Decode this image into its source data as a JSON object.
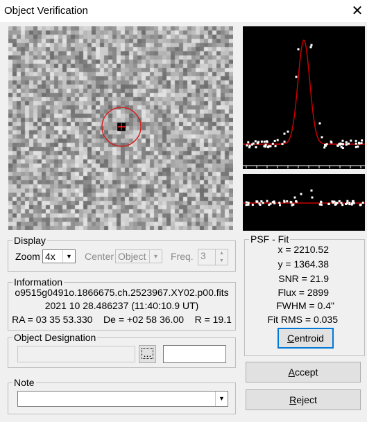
{
  "window": {
    "title": "Object Verification",
    "close_glyph": "✕"
  },
  "display": {
    "legend": "Display",
    "zoom_label": "Zoom",
    "zoom_value": "4x",
    "center_label": "Center",
    "center_value": "Object",
    "freq_label": "Freq.",
    "freq_value": "3"
  },
  "information": {
    "legend": "Information",
    "filename": "o9515g0491o.1866675.ch.2523967.XY02.p00.fits",
    "datetime": "2021 10 28.486237 (11:40:10.9 UT)",
    "coords": "RA = 03 35 53.330    De = +02 58 36.00    R = 19.1"
  },
  "designation": {
    "legend": "Object Designation",
    "browse_label": "..."
  },
  "note": {
    "legend": "Note"
  },
  "psf": {
    "legend": "PSF - Fit",
    "x": "x = 2210.52",
    "y": "y = 1364.38",
    "snr": "SNR = 21.9",
    "flux": "Flux = 2899",
    "fwhm": "FWHM = 0.4\"",
    "rms": "Fit RMS = 0.035",
    "centroid_prefix": "C",
    "centroid_rest": "entroid"
  },
  "actions": {
    "accept_prefix": "A",
    "accept_rest": "ccept",
    "reject_prefix": "R",
    "reject_rest": "eject"
  },
  "colors": {
    "fit_curve": "#cc0000",
    "circle": "#d42020",
    "accent": "#0078d7"
  }
}
